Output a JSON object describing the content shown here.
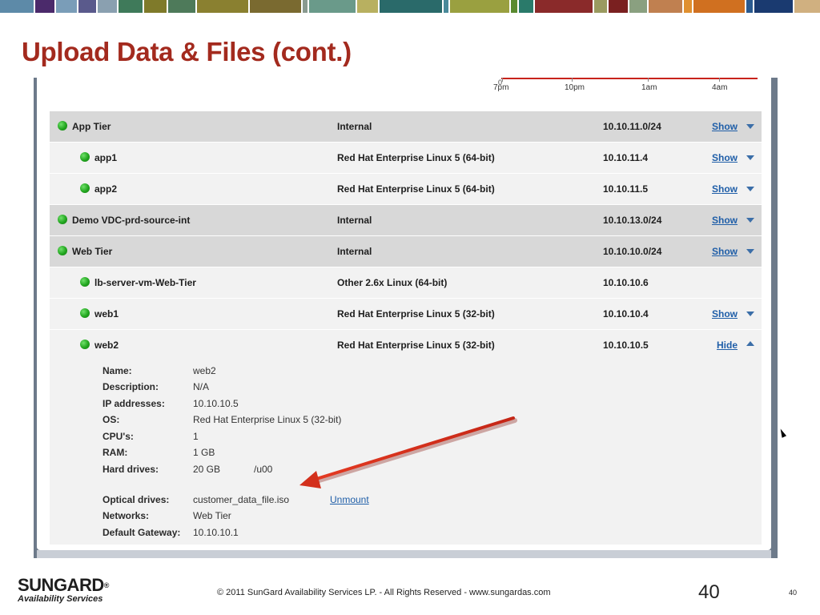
{
  "top_bar": {
    "colors": [
      "#5d8aa8",
      "#4b2a6b",
      "#7a9db8",
      "#5a5a8c",
      "#8aa0b0",
      "#3f7a5a",
      "#7f7a2a",
      "#4e7a5a",
      "#8a8030",
      "#7a6a30",
      "#8a9a90",
      "#6a9a8a",
      "#b8b060",
      "#2a6a6a",
      "#4a8a9a",
      "#9aa040",
      "#5a8a30",
      "#2a7a6a",
      "#8a2a2a",
      "#9a9a60",
      "#7a2020",
      "#8aa080",
      "#c08050",
      "#e09030",
      "#d07020",
      "#2a5a90",
      "#1a3a70",
      "#d0b080"
    ]
  },
  "slide": {
    "title": "Upload Data & Files (cont.)"
  },
  "chart_strip": {
    "axis_label": "0",
    "ticks": [
      "7pm",
      "10pm",
      "1am",
      "4am"
    ]
  },
  "rows": [
    {
      "kind": "tier",
      "name": "App Tier",
      "os": "Internal",
      "ip": "10.10.11.0/24",
      "toggle": "Show"
    },
    {
      "kind": "vm",
      "name": "app1",
      "os": "Red Hat Enterprise Linux 5 (64-bit)",
      "ip": "10.10.11.4",
      "toggle": "Show"
    },
    {
      "kind": "vm",
      "name": "app2",
      "os": "Red Hat Enterprise Linux 5 (64-bit)",
      "ip": "10.10.11.5",
      "toggle": "Show"
    },
    {
      "kind": "tier",
      "name": "Demo VDC-prd-source-int",
      "os": "Internal",
      "ip": "10.10.13.0/24",
      "toggle": "Show"
    },
    {
      "kind": "tier",
      "name": "Web Tier",
      "os": "Internal",
      "ip": "10.10.10.0/24",
      "toggle": "Show"
    },
    {
      "kind": "vm",
      "name": "lb-server-vm-Web-Tier",
      "os": "Other 2.6x Linux (64-bit)",
      "ip": "10.10.10.6",
      "toggle": ""
    },
    {
      "kind": "vm",
      "name": "web1",
      "os": "Red Hat Enterprise Linux 5 (32-bit)",
      "ip": "10.10.10.4",
      "toggle": "Show"
    },
    {
      "kind": "vm",
      "name": "web2",
      "os": "Red Hat Enterprise Linux 5 (32-bit)",
      "ip": "10.10.10.5",
      "toggle": "Hide"
    }
  ],
  "details": {
    "name_label": "Name:",
    "name_value": "web2",
    "description_label": "Description:",
    "description_value": "N/A",
    "ip_label": "IP addresses:",
    "ip_value": "10.10.10.5",
    "os_label": "OS:",
    "os_value": "Red Hat Enterprise Linux 5 (32-bit)",
    "cpu_label": "CPU's:",
    "cpu_value": "1",
    "ram_label": "RAM:",
    "ram_value": "1 GB",
    "hd_label": "Hard drives:",
    "hd_size": "20 GB",
    "hd_mount": "/u00",
    "optical_label": "Optical drives:",
    "optical_value": "customer_data_file.iso",
    "optical_action": "Unmount",
    "networks_label": "Networks:",
    "networks_value": "Web Tier",
    "gateway_label": "Default Gateway:",
    "gateway_value": "10.10.10.1"
  },
  "footer": {
    "logo_main": "SUNGARD",
    "logo_reg": "®",
    "logo_sub": "Availability Services",
    "copyright": "© 2011 SunGard Availability Services LP. - All Rights Reserved - www.sungardas.com",
    "page_big": "40",
    "page_small": "40"
  }
}
